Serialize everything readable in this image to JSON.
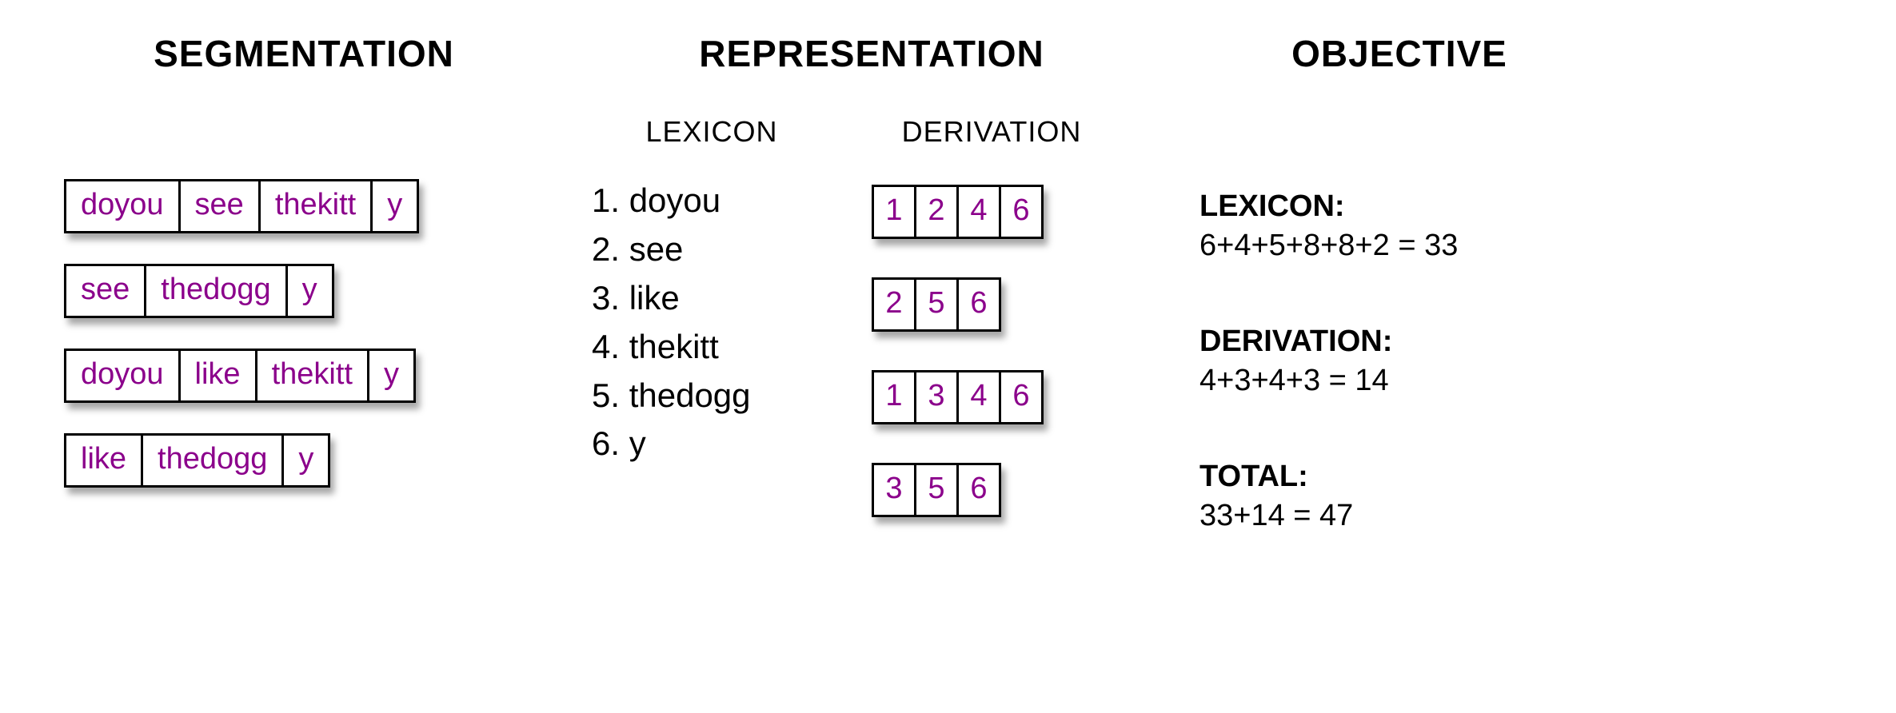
{
  "headings": {
    "segmentation": "SEGMENTATION",
    "representation": "REPRESENTATION",
    "objective": "OBJECTIVE",
    "lexicon_sub": "LEXICON",
    "derivation_sub": "DERIVATION"
  },
  "segmentation": {
    "rows": [
      [
        "doyou",
        "see",
        "thekitt",
        "y"
      ],
      [
        "see",
        "thedogg",
        "y"
      ],
      [
        "doyou",
        "like",
        "thekitt",
        "y"
      ],
      [
        "like",
        "thedogg",
        "y"
      ]
    ]
  },
  "lexicon": {
    "items": [
      {
        "index": "1.",
        "word": "doyou"
      },
      {
        "index": "2.",
        "word": "see"
      },
      {
        "index": "3.",
        "word": "like"
      },
      {
        "index": "4.",
        "word": "thekitt"
      },
      {
        "index": "5.",
        "word": "thedogg"
      },
      {
        "index": "6.",
        "word": "y"
      }
    ]
  },
  "derivation": {
    "rows": [
      [
        "1",
        "2",
        "4",
        "6"
      ],
      [
        "2",
        "5",
        "6"
      ],
      [
        "1",
        "3",
        "4",
        "6"
      ],
      [
        "3",
        "5",
        "6"
      ]
    ]
  },
  "objective": {
    "lexicon_label": "LEXICON:",
    "lexicon_calc": "6+4+5+8+8+2 = 33",
    "derivation_label": "DERIVATION:",
    "derivation_calc": "4+3+4+3 = 14",
    "total_label": "TOTAL:",
    "total_calc": "33+14 = 47"
  }
}
